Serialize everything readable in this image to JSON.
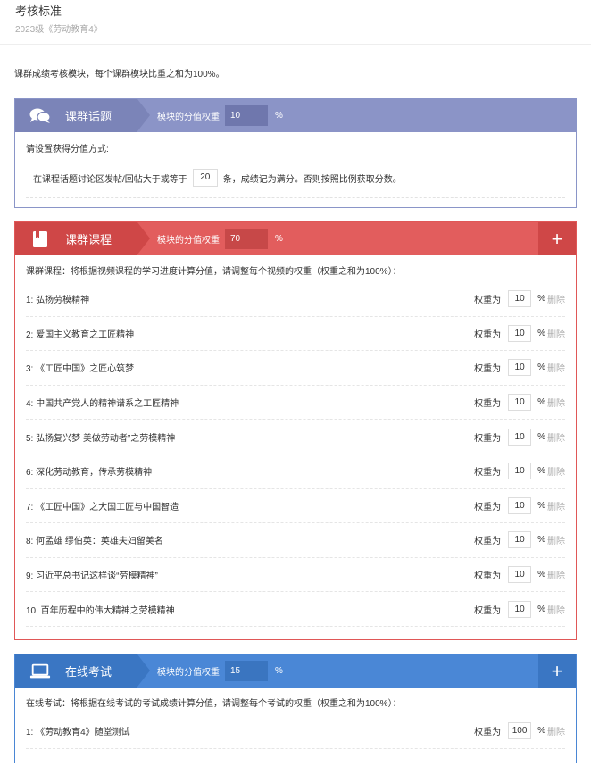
{
  "header": {
    "title": "考核标准",
    "subtitle": "2023级《劳动教育4》"
  },
  "intro": "课群成绩考核模块，每个课群模块比重之和为100%。",
  "common": {
    "weight_label": "模块的分值权重",
    "percent": "%",
    "row_weight_label": "权重为",
    "delete_label": "删除",
    "add_symbol": "+"
  },
  "topic": {
    "name": "课群话题",
    "weight": "10",
    "prompt": "请设置获得分值方式:",
    "rule_before": "在课程话题讨论区发帖/回帖大于或等于",
    "rule_value": "20",
    "rule_after": "条，成绩记为满分。否则按照比例获取分数。"
  },
  "course": {
    "name": "课群课程",
    "weight": "70",
    "desc": "课群课程：将根据视频课程的学习进度计算分值，请调整每个视频的权重（权重之和为100%）：",
    "items": [
      {
        "label": "1:  弘扬劳模精神",
        "weight": "10"
      },
      {
        "label": "2:  爱国主义教育之工匠精神",
        "weight": "10"
      },
      {
        "label": "3:  《工匠中国》之匠心筑梦",
        "weight": "10"
      },
      {
        "label": "4:  中国共产党人的精神谱系之工匠精神",
        "weight": "10"
      },
      {
        "label": "5:  弘扬复兴梦 美做劳动者”之劳模精神",
        "weight": "10"
      },
      {
        "label": "6:  深化劳动教育，传承劳模精神",
        "weight": "10"
      },
      {
        "label": "7:  《工匠中国》之大国工匠与中国智造",
        "weight": "10"
      },
      {
        "label": "8:  何孟雄 缪伯英：英雄夫妇留美名",
        "weight": "10"
      },
      {
        "label": "9:  习近平总书记这样谈“劳模精神”",
        "weight": "10"
      },
      {
        "label": "10:  百年历程中的伟大精神之劳模精神",
        "weight": "10"
      }
    ]
  },
  "exam": {
    "name": "在线考试",
    "weight": "15",
    "desc": "在线考试：将根据在线考试的考试成绩计算分值，请调整每个考试的权重（权重之和为100%）：",
    "items": [
      {
        "label": "1:  《劳动教育4》随堂测试",
        "weight": "100"
      }
    ]
  },
  "colors": {
    "topic": "#8b94c7",
    "course": "#e25d5d",
    "exam": "#4a87d6"
  },
  "icons": {
    "topic": "chat-bubbles-icon",
    "course": "book-icon",
    "exam": "laptop-icon"
  }
}
